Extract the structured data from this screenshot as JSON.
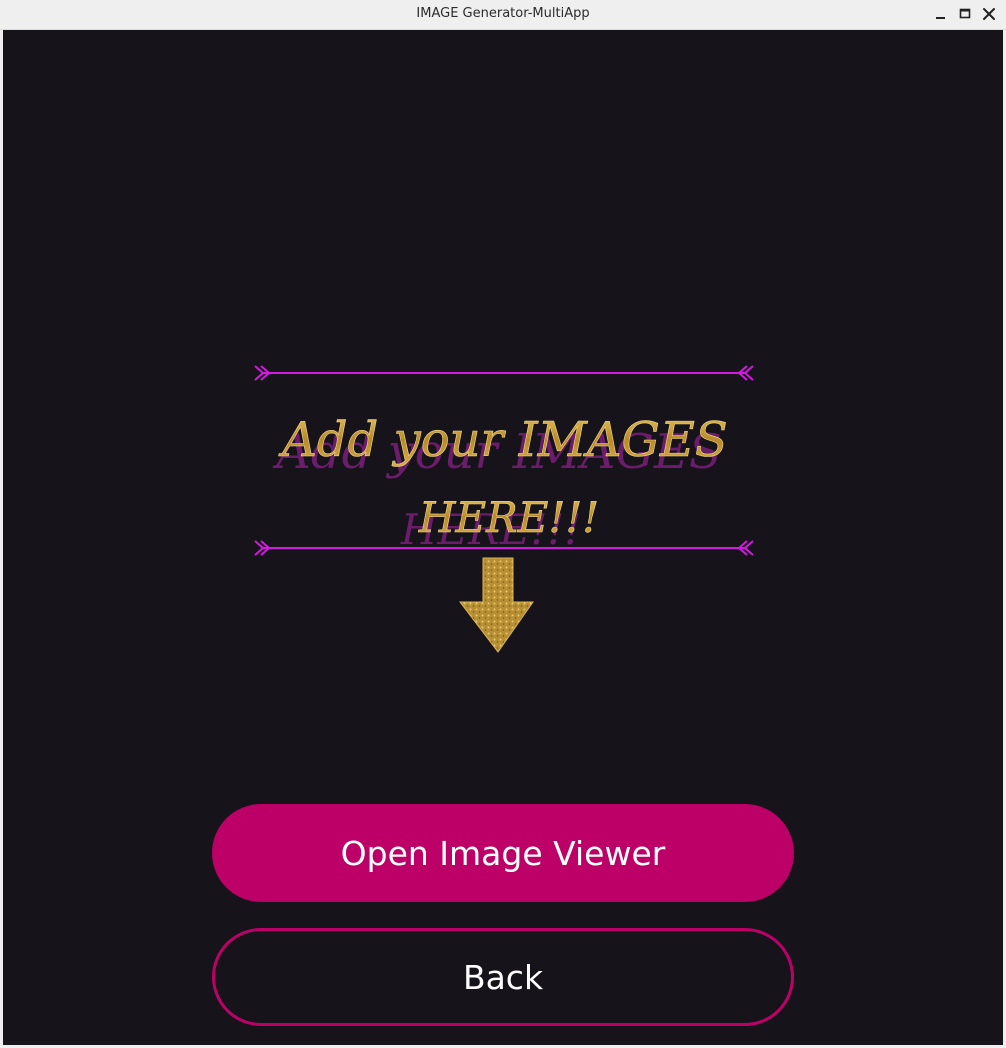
{
  "window": {
    "title": "IMAGE Generator-MultiApp",
    "controls": [
      "minimize-icon",
      "maximize-icon",
      "close-icon"
    ]
  },
  "banner": {
    "line1": "Add your IMAGES",
    "line2": "HERE!!!",
    "arrow_icon": "down-arrow-icon",
    "divider_icon": "chevron-arrow-line"
  },
  "buttons": {
    "open_label": "Open Image Viewer",
    "back_label": "Back"
  },
  "colors": {
    "background": "#16131b",
    "accent": "#bd0068",
    "divider": "#d21ae0",
    "gold": "#c9a33b",
    "shadow": "#7a1f7a"
  }
}
